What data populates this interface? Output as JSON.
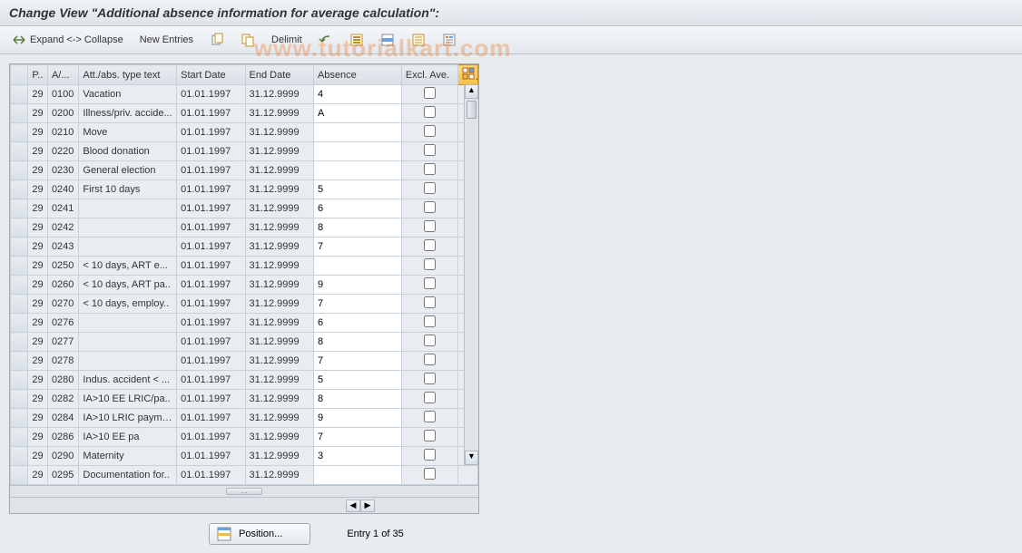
{
  "title": "Change View \"Additional absence information for average calculation\":",
  "watermark": "www.tutorialkart.com",
  "toolbar": {
    "expand_collapse": "Expand <-> Collapse",
    "new_entries": "New Entries",
    "delimit": "Delimit"
  },
  "columns": {
    "p": "P..",
    "a": "A/...",
    "text": "Att./abs. type text",
    "start": "Start Date",
    "end": "End Date",
    "absence": "Absence",
    "excl": "Excl. Ave."
  },
  "rows": [
    {
      "p": "29",
      "a": "0100",
      "text": "Vacation",
      "start": "01.01.1997",
      "end": "31.12.9999",
      "absence": "4",
      "excl": false
    },
    {
      "p": "29",
      "a": "0200",
      "text": "Illness/priv. accide...",
      "start": "01.01.1997",
      "end": "31.12.9999",
      "absence": "A",
      "excl": false
    },
    {
      "p": "29",
      "a": "0210",
      "text": "Move",
      "start": "01.01.1997",
      "end": "31.12.9999",
      "absence": "",
      "excl": false
    },
    {
      "p": "29",
      "a": "0220",
      "text": "Blood donation",
      "start": "01.01.1997",
      "end": "31.12.9999",
      "absence": "",
      "excl": false
    },
    {
      "p": "29",
      "a": "0230",
      "text": "General election",
      "start": "01.01.1997",
      "end": "31.12.9999",
      "absence": "",
      "excl": false
    },
    {
      "p": "29",
      "a": "0240",
      "text": "First 10 days",
      "start": "01.01.1997",
      "end": "31.12.9999",
      "absence": "5",
      "excl": false
    },
    {
      "p": "29",
      "a": "0241",
      "text": "",
      "start": "01.01.1997",
      "end": "31.12.9999",
      "absence": "6",
      "excl": false
    },
    {
      "p": "29",
      "a": "0242",
      "text": "",
      "start": "01.01.1997",
      "end": "31.12.9999",
      "absence": "8",
      "excl": false
    },
    {
      "p": "29",
      "a": "0243",
      "text": "",
      "start": "01.01.1997",
      "end": "31.12.9999",
      "absence": "7",
      "excl": false
    },
    {
      "p": "29",
      "a": "0250",
      "text": "< 10 days, ART e...",
      "start": "01.01.1997",
      "end": "31.12.9999",
      "absence": "",
      "excl": false
    },
    {
      "p": "29",
      "a": "0260",
      "text": "< 10 days, ART pa..",
      "start": "01.01.1997",
      "end": "31.12.9999",
      "absence": "9",
      "excl": false
    },
    {
      "p": "29",
      "a": "0270",
      "text": "< 10 days, employ..",
      "start": "01.01.1997",
      "end": "31.12.9999",
      "absence": "7",
      "excl": false
    },
    {
      "p": "29",
      "a": "0276",
      "text": "",
      "start": "01.01.1997",
      "end": "31.12.9999",
      "absence": "6",
      "excl": false
    },
    {
      "p": "29",
      "a": "0277",
      "text": "",
      "start": "01.01.1997",
      "end": "31.12.9999",
      "absence": "8",
      "excl": false
    },
    {
      "p": "29",
      "a": "0278",
      "text": "",
      "start": "01.01.1997",
      "end": "31.12.9999",
      "absence": "7",
      "excl": false
    },
    {
      "p": "29",
      "a": "0280",
      "text": "Indus. accident < ...",
      "start": "01.01.1997",
      "end": "31.12.9999",
      "absence": "5",
      "excl": false
    },
    {
      "p": "29",
      "a": "0282",
      "text": "IA>10 EE LRIC/pa..",
      "start": "01.01.1997",
      "end": "31.12.9999",
      "absence": "8",
      "excl": false
    },
    {
      "p": "29",
      "a": "0284",
      "text": "IA>10 LRIC payme..",
      "start": "01.01.1997",
      "end": "31.12.9999",
      "absence": "9",
      "excl": false
    },
    {
      "p": "29",
      "a": "0286",
      "text": "IA>10 EE pa",
      "start": "01.01.1997",
      "end": "31.12.9999",
      "absence": "7",
      "excl": false
    },
    {
      "p": "29",
      "a": "0290",
      "text": "Maternity",
      "start": "01.01.1997",
      "end": "31.12.9999",
      "absence": "3",
      "excl": false
    },
    {
      "p": "29",
      "a": "0295",
      "text": "Documentation for..",
      "start": "01.01.1997",
      "end": "31.12.9999",
      "absence": "",
      "excl": false
    }
  ],
  "footer": {
    "position": "Position...",
    "entry_info": "Entry 1 of 35"
  }
}
